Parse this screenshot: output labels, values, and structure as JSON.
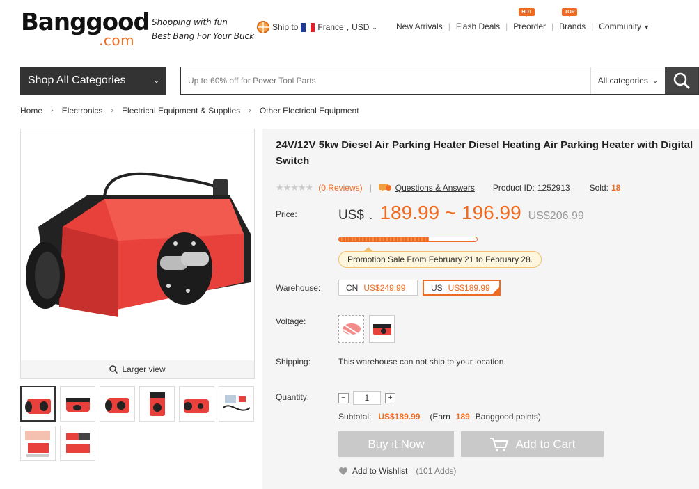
{
  "logo": {
    "main": "Banggood",
    "sub": ".com"
  },
  "slogan": {
    "line1": "Shopping with fun",
    "line2": "Best Bang For Your Buck"
  },
  "ship": {
    "label": "Ship to",
    "country": "France",
    "currency": "USD"
  },
  "nav": {
    "items": [
      {
        "label": "New Arrivals"
      },
      {
        "label": "Flash Deals"
      },
      {
        "label": "Preorder",
        "badge": "HOT"
      },
      {
        "label": "Brands",
        "badge": "TOP"
      },
      {
        "label": "Community"
      }
    ]
  },
  "shop_all": "Shop All Categories",
  "search": {
    "placeholder": "Up to 60% off for Power Tool Parts",
    "category": "All categories"
  },
  "breadcrumb": [
    "Home",
    "Electronics",
    "Electrical Equipment & Supplies",
    "Other Electrical Equipment"
  ],
  "gallery": {
    "larger_view": "Larger view"
  },
  "product": {
    "title": "24V/12V 5kw Diesel Air Parking Heater Diesel Heating Air Parking Heater with Digital Switch",
    "reviews": "(0 Reviews)",
    "qa": "Questions & Answers",
    "product_id_label": "Product ID:",
    "product_id": "1252913",
    "sold_label": "Sold:",
    "sold": "18",
    "price_label": "Price:",
    "currency": "US$",
    "price_range": "189.99 ~ 196.99",
    "old_price": "US$206.99",
    "promo_progress": 0.65,
    "promo": "Promotion Sale From February 21 to February 28.",
    "warehouse_label": "Warehouse:",
    "warehouses": [
      {
        "code": "CN",
        "price": "US$249.99"
      },
      {
        "code": "US",
        "price": "US$189.99"
      }
    ],
    "voltage_label": "Voltage:",
    "shipping_label": "Shipping:",
    "shipping": "This warehouse can not ship to your location.",
    "quantity_label": "Quantity:",
    "quantity": "1",
    "subtotal_label": "Subtotal:",
    "subtotal": "US$189.99",
    "earn_prefix": "(Earn",
    "points": "189",
    "earn_suffix": "Banggood points)",
    "buy": "Buy it Now",
    "cart": "Add to Cart",
    "wishlist": "Add to Wishlist",
    "wish_count": "(101 Adds)"
  },
  "colors": {
    "accent": "#f06b22",
    "dark": "#333333",
    "disabled": "#c9c9c9"
  }
}
